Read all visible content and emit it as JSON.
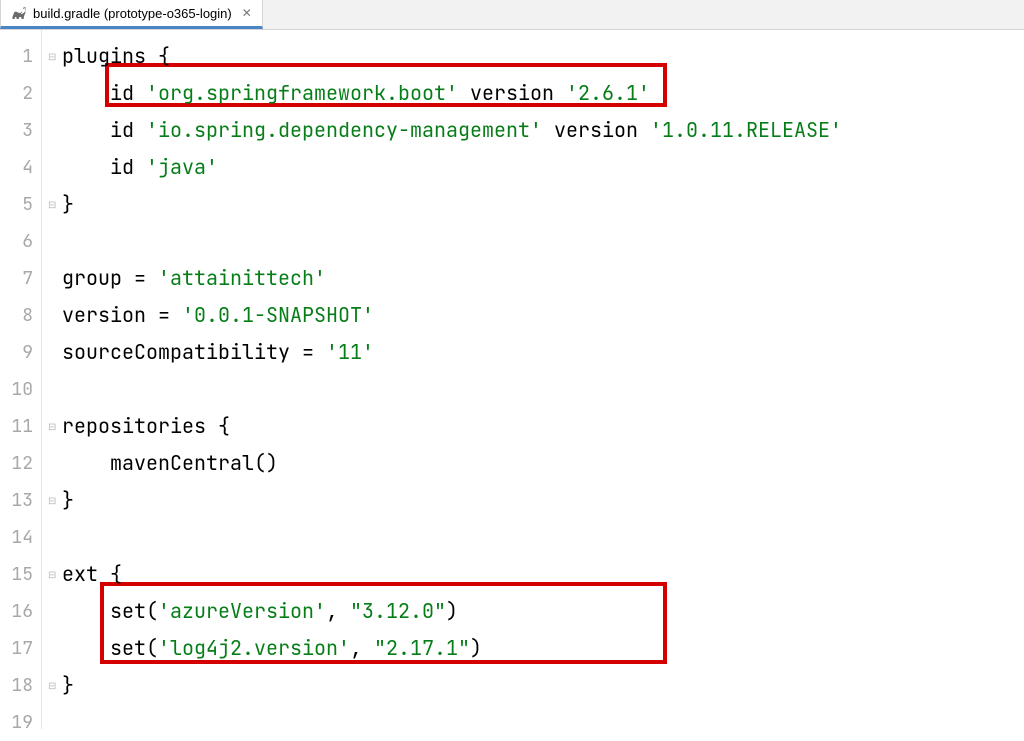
{
  "tab": {
    "filename": "build.gradle (prototype-o365-login)"
  },
  "gutter": {
    "lines": [
      "1",
      "2",
      "3",
      "4",
      "5",
      "6",
      "7",
      "8",
      "9",
      "10",
      "11",
      "12",
      "13",
      "14",
      "15",
      "16",
      "17",
      "18",
      "19"
    ]
  },
  "code": {
    "l1": {
      "kw": "plugins",
      "brace": " {"
    },
    "l2": {
      "t1": "    id ",
      "s1": "'org.springframework.boot'",
      "t2": " version ",
      "s2": "'2.6.1'"
    },
    "l3": {
      "t1": "    id ",
      "s1": "'io.spring.dependency-management'",
      "t2": " version ",
      "s2": "'1.0.11.RELEASE'"
    },
    "l4": {
      "t1": "    id ",
      "s1": "'java'"
    },
    "l5": {
      "brace": "}"
    },
    "l7": {
      "t1": "group = ",
      "s1": "'attainittech'"
    },
    "l8": {
      "t1": "version = ",
      "s1": "'0.0.1-SNAPSHOT'"
    },
    "l9": {
      "t1": "sourceCompatibility = ",
      "s1": "'11'"
    },
    "l11": {
      "kw": "repositories",
      "brace": " {"
    },
    "l12": {
      "t1": "    mavenCentral()"
    },
    "l13": {
      "brace": "}"
    },
    "l15": {
      "kw": "ext",
      "brace": " {"
    },
    "l16": {
      "t1": "    set(",
      "s1": "'azureVersion'",
      "t2": ", ",
      "s2": "\"3.12.0\"",
      "t3": ")"
    },
    "l17": {
      "t1": "    set(",
      "s1": "'log4j2.version'",
      "t2": ", ",
      "s2": "\"2.17.1\"",
      "t3": ")"
    },
    "l18": {
      "brace": "}"
    }
  }
}
